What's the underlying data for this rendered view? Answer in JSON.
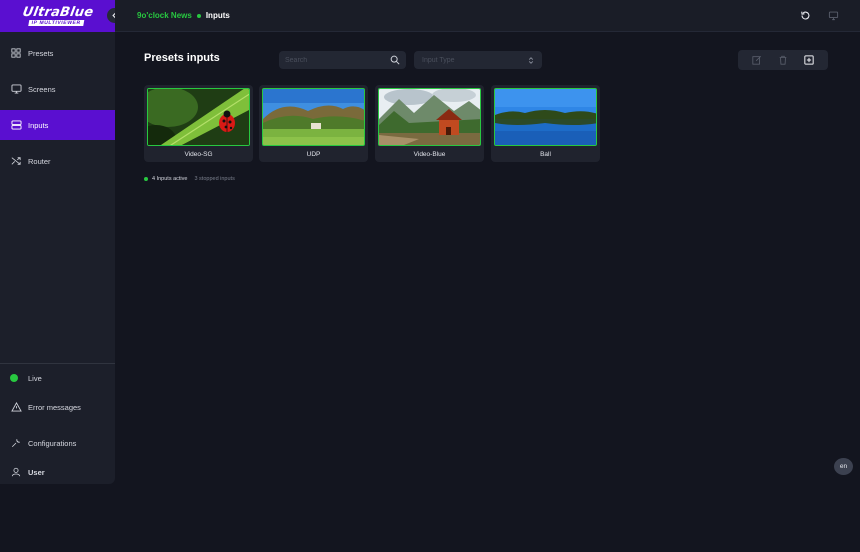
{
  "logo": {
    "main": "UltraBlue",
    "sub": "IP MULTIVIEWER"
  },
  "breadcrumb": {
    "parent": "9o'clock News",
    "current": "Inputs"
  },
  "sidebar": {
    "items": [
      {
        "label": "Presets",
        "icon": "grid-icon"
      },
      {
        "label": "Screens",
        "icon": "monitor-icon"
      },
      {
        "label": "Inputs",
        "icon": "inputs-icon",
        "active": true
      },
      {
        "label": "Router",
        "icon": "shuffle-icon"
      }
    ],
    "bottom": [
      {
        "label": "Live",
        "icon": "live-dot"
      },
      {
        "label": "Error messages",
        "icon": "warning-icon"
      },
      {
        "label": "Configurations",
        "icon": "wrench-icon"
      },
      {
        "label": "User",
        "icon": "user-icon"
      }
    ]
  },
  "main": {
    "title": "Presets inputs",
    "search_placeholder": "Search",
    "input_type_placeholder": "Input Type"
  },
  "cards": [
    {
      "label": "Video-SG",
      "thumbnail": "ladybug-on-leaf"
    },
    {
      "label": "UDP",
      "thumbnail": "green-meadow-hills"
    },
    {
      "label": "Video-Blue",
      "thumbnail": "mountain-cabin"
    },
    {
      "label": "Ball",
      "thumbnail": "blue-lake"
    }
  ],
  "status": {
    "active": "4 Inputs active",
    "stopped": "3 stopped inputs"
  },
  "language": "en",
  "colors": {
    "accent": "#5a0fd0",
    "active_green": "#28c840",
    "background": "#13151f",
    "panel": "#1c1f2a"
  }
}
